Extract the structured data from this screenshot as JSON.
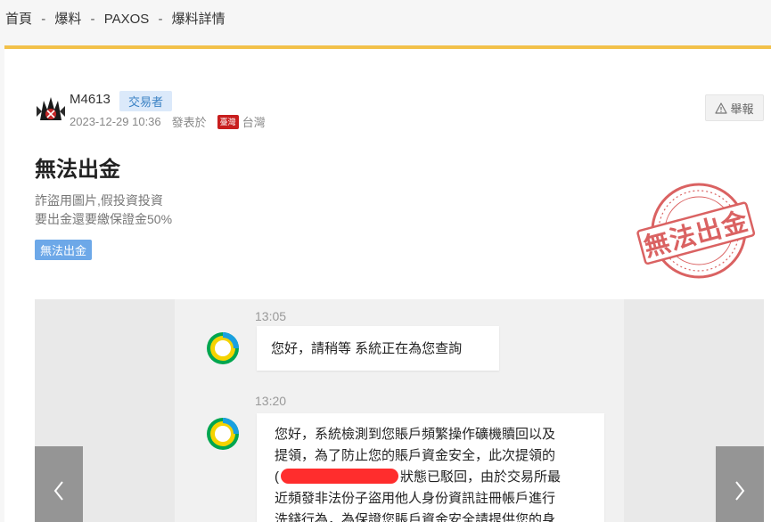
{
  "breadcrumb": {
    "items": [
      "首頁",
      "爆料",
      "PAXOS",
      "爆料詳情"
    ],
    "separator": "-"
  },
  "post": {
    "username": "M4613",
    "role": "交易者",
    "datetime": "2023-12-29 10:36",
    "posted_from_label": "發表於",
    "flag_text": "臺灣",
    "region": "台灣",
    "report_label": "舉報",
    "title": "無法出金",
    "body_lines": [
      "詐盜用圖片,假投資投資",
      "要出金還要繳保證金50%"
    ],
    "tag": "無法出金",
    "stamp_text": "無法出金"
  },
  "gallery": {
    "chat": {
      "messages": [
        {
          "time": "13:05",
          "text": "您好，請稍等 系統正在為您查詢"
        },
        {
          "time": "13:20",
          "lines": [
            "您好，系統檢測到您賬戶頻繁操作礦機贖回以及",
            "提領，為了防止您的賬戶資金安全，此次提領的",
            "(",
            "狀態已駁回，由於交易所最",
            "近頻發非法份子盜用他人身份資訊註冊帳戶進行",
            "洗錢行為，為保證您賬戶資金安全請提供您的身"
          ]
        }
      ]
    }
  },
  "colors": {
    "accent_bar": "#f2c14a",
    "role_badge_bg": "#dbe9fa",
    "tag_bg": "#6da8e8",
    "stamp_red": "#d23c3c",
    "redaction": "#ff2d2d"
  },
  "icons": {
    "report": "warning-triangle-icon",
    "prev": "chevron-left-icon",
    "next": "chevron-right-icon"
  }
}
